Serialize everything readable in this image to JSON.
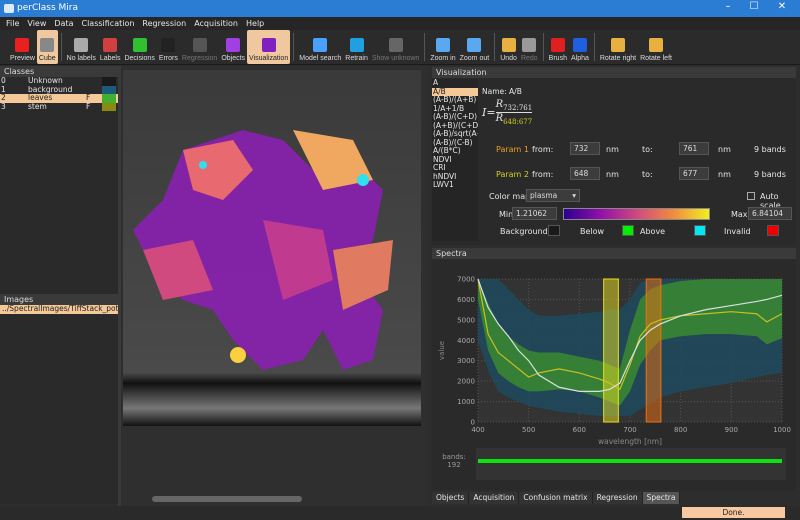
{
  "window": {
    "title": "perClass Mira",
    "controls": [
      "–",
      "☐",
      "✕"
    ]
  },
  "menu": [
    "File",
    "View",
    "Data",
    "Classification",
    "Regression",
    "Acquisition",
    "Help"
  ],
  "toolbar": [
    {
      "label": "Preview",
      "color": "#e82020",
      "state": "normal"
    },
    {
      "label": "Cube",
      "color": "#888888",
      "state": "active"
    },
    {
      "sep": true
    },
    {
      "label": "No labels",
      "color": "#aaaaaa",
      "state": "normal"
    },
    {
      "label": "Labels",
      "color": "#d04040",
      "state": "normal"
    },
    {
      "label": "Decisions",
      "color": "#30c030",
      "state": "normal"
    },
    {
      "label": "Errors",
      "color": "#222222",
      "state": "normal"
    },
    {
      "label": "Regression",
      "color": "#555555",
      "state": "disabled"
    },
    {
      "label": "Objects",
      "color": "#a040e0",
      "state": "normal"
    },
    {
      "label": "Visualization",
      "color": "#8020c0",
      "state": "active"
    },
    {
      "sep": true
    },
    {
      "label": "Model search",
      "color": "#4aa0ff",
      "state": "normal"
    },
    {
      "label": "Retrain",
      "color": "#20a0e0",
      "state": "normal"
    },
    {
      "label": "Show unknown",
      "color": "#666666",
      "state": "disabled"
    },
    {
      "sep": true
    },
    {
      "label": "Zoom in",
      "color": "#5aa8f0",
      "state": "normal"
    },
    {
      "label": "Zoom out",
      "color": "#5aa8f0",
      "state": "normal"
    },
    {
      "sep": true
    },
    {
      "label": "Undo",
      "color": "#e8b040",
      "state": "normal"
    },
    {
      "label": "Redo",
      "color": "#999999",
      "state": "disabled"
    },
    {
      "sep": true
    },
    {
      "label": "Brush",
      "color": "#e02020",
      "state": "normal"
    },
    {
      "label": "Alpha",
      "color": "#2060e0",
      "state": "normal"
    },
    {
      "sep": true
    },
    {
      "label": "Rotate right",
      "color": "#e8b040",
      "state": "normal"
    },
    {
      "label": "Rotate left",
      "color": "#e8b040",
      "state": "normal"
    }
  ],
  "classes": {
    "title": "Classes",
    "items": [
      {
        "id": "0",
        "name": "Unknown",
        "flag": "",
        "color": "#1a1a1a"
      },
      {
        "id": "1",
        "name": "background",
        "flag": "",
        "color": "#1e5a7a"
      },
      {
        "id": "2",
        "name": "leaves",
        "flag": "F",
        "color": "#40b030",
        "selected": true
      },
      {
        "id": "3",
        "name": "stem",
        "flag": "F",
        "color": "#8a8a10"
      }
    ]
  },
  "images": {
    "title": "Images",
    "items": [
      "../SpectralImages/TiffStack_potato_"
    ]
  },
  "visualization": {
    "title": "Visualization",
    "list": [
      "A",
      "A/B",
      "(A-B)/(A+B)",
      "1/A+1/B",
      "(A-B)/(C+D)",
      "(A+B)/(C+D)",
      "(A-B)/sqrt(A+",
      "(A-B)/(C-B)",
      "A/(B*C)",
      "NDVI",
      "CRI",
      "hNDVI",
      "LWV1"
    ],
    "selected": "A/B",
    "name": "Name: A/B",
    "formula": {
      "lhs": "I=",
      "num": "R",
      "num_sub": "732:761",
      "den": "R",
      "den_sub": "648:677"
    },
    "params": [
      {
        "label": "Param 1",
        "color": "#e8a020",
        "from_label": "from:",
        "from": "732",
        "unit": "nm",
        "to_label": "to:",
        "to": "761",
        "bands": "9 bands"
      },
      {
        "label": "Param 2",
        "color": "#d0d020",
        "from_label": "from:",
        "from": "648",
        "unit": "nm",
        "to_label": "to:",
        "to": "677",
        "bands": "9 bands"
      }
    ],
    "colormap_label": "Color map",
    "colormap": "plasma",
    "autoscale": "Auto scale",
    "min_label": "Min",
    "min": "1.21062",
    "max_label": "Max",
    "max": "6.84104",
    "swatches": [
      {
        "label": "Background",
        "color": "#1a1a1a"
      },
      {
        "label": "Below",
        "color": "#00ee00"
      },
      {
        "label": "Above",
        "color": "#00e8f0"
      },
      {
        "label": "Invalid",
        "color": "#ee0000"
      }
    ]
  },
  "spectra": {
    "title": "Spectra",
    "bands_label": "bands:",
    "bands_count": "192"
  },
  "chart_data": {
    "type": "line",
    "xlabel": "wavelength [nm]",
    "ylabel": "value",
    "xlim": [
      400,
      1000
    ],
    "ylim": [
      0,
      7000
    ],
    "xticks": [
      400,
      500,
      600,
      700,
      800,
      900,
      1000
    ],
    "yticks": [
      0,
      1000,
      2000,
      3000,
      4000,
      5000,
      6000,
      7000
    ],
    "x": [
      400,
      420,
      440,
      460,
      480,
      500,
      520,
      560,
      600,
      640,
      660,
      680,
      700,
      720,
      740,
      760,
      800,
      850,
      900,
      950,
      970,
      1000
    ],
    "series": [
      {
        "name": "leaves",
        "color": "#c8c020",
        "values": [
          7000,
          4300,
          3400,
          3000,
          2600,
          2200,
          2400,
          2600,
          2400,
          2100,
          1900,
          1600,
          2800,
          4200,
          4800,
          5000,
          5200,
          5300,
          5400,
          5300,
          4900,
          5300
        ],
        "upper": [
          7000,
          5800,
          4800,
          4200,
          3800,
          3500,
          3400,
          3400,
          3200,
          3000,
          2800,
          2600,
          4500,
          6000,
          6500,
          6700,
          6900,
          7000,
          7000,
          7000,
          7000,
          7000
        ],
        "lower": [
          6000,
          3500,
          2400,
          2000,
          1700,
          1500,
          1500,
          1600,
          1500,
          1200,
          1000,
          800,
          1500,
          2800,
          3500,
          4000,
          4200,
          4300,
          4300,
          4200,
          3800,
          4100
        ],
        "band_color": "#3a8a30"
      },
      {
        "name": "background",
        "color": "#d8e0e0",
        "values": [
          7000,
          5600,
          4800,
          4200,
          3500,
          3000,
          2300,
          1700,
          1500,
          1500,
          1600,
          1900,
          3000,
          4000,
          4500,
          4800,
          5200,
          5500,
          5700,
          5900,
          6000,
          6200
        ],
        "upper": [
          7000,
          7000,
          7000,
          6500,
          6000,
          5500,
          5200,
          5200,
          5300,
          5400,
          5500,
          5500,
          6000,
          6800,
          7000,
          7000,
          7000,
          7000,
          7000,
          7000,
          7000,
          7000
        ],
        "lower": [
          4000,
          2500,
          1500,
          1200,
          1000,
          800,
          700,
          500,
          400,
          300,
          300,
          300,
          300,
          600,
          900,
          1200,
          1500,
          1700,
          1900,
          2200,
          2300,
          2400
        ],
        "band_color": "#1e4a5e"
      }
    ],
    "highlights": [
      {
        "from": 648,
        "to": 677,
        "color": "#e8e020"
      },
      {
        "from": 732,
        "to": 761,
        "color": "#f07010"
      }
    ]
  },
  "bottom_tabs": [
    "Objects",
    "Acquisition",
    "Confusion matrix",
    "Regression",
    "Spectra"
  ],
  "active_tab": "Spectra",
  "status": "Done."
}
